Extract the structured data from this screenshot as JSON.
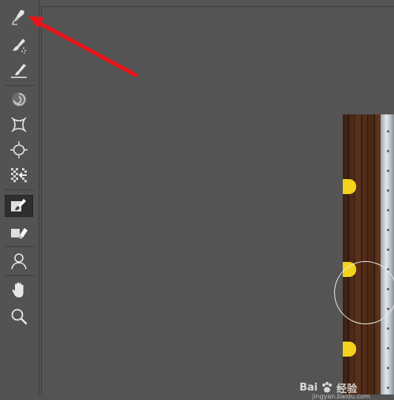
{
  "toolbar": {
    "tools": [
      {
        "name": "liquify-brush-tool",
        "icon": "brush-pen-icon",
        "active": false
      },
      {
        "name": "smudge-brush-tool",
        "icon": "smudge-brush-icon",
        "active": false
      },
      {
        "name": "smooth-tool",
        "icon": "smooth-brush-icon",
        "active": false
      },
      {
        "name": "twirl-tool",
        "icon": "twirl-icon",
        "active": false
      },
      {
        "name": "pucker-tool",
        "icon": "pucker-icon",
        "active": false
      },
      {
        "name": "bloat-tool",
        "icon": "bloat-icon",
        "active": false
      },
      {
        "name": "push-left-tool",
        "icon": "push-left-icon",
        "active": false
      },
      {
        "name": "freeze-mask-tool",
        "icon": "freeze-mask-icon",
        "active": true
      },
      {
        "name": "thaw-mask-tool",
        "icon": "eraser-icon",
        "active": false
      },
      {
        "name": "face-tool",
        "icon": "person-icon",
        "active": false
      },
      {
        "name": "hand-tool",
        "icon": "hand-icon",
        "active": false
      },
      {
        "name": "zoom-tool",
        "icon": "magnifier-icon",
        "active": false
      }
    ]
  },
  "colors": {
    "panel_bg": "#535353",
    "active_tool_bg": "#2f2f2f",
    "arrow": "#e8141b",
    "yellow": "#f2d21c"
  },
  "watermark": {
    "text": "Bai",
    "suffix": "经验",
    "url": "jingyan.baidu.com"
  }
}
